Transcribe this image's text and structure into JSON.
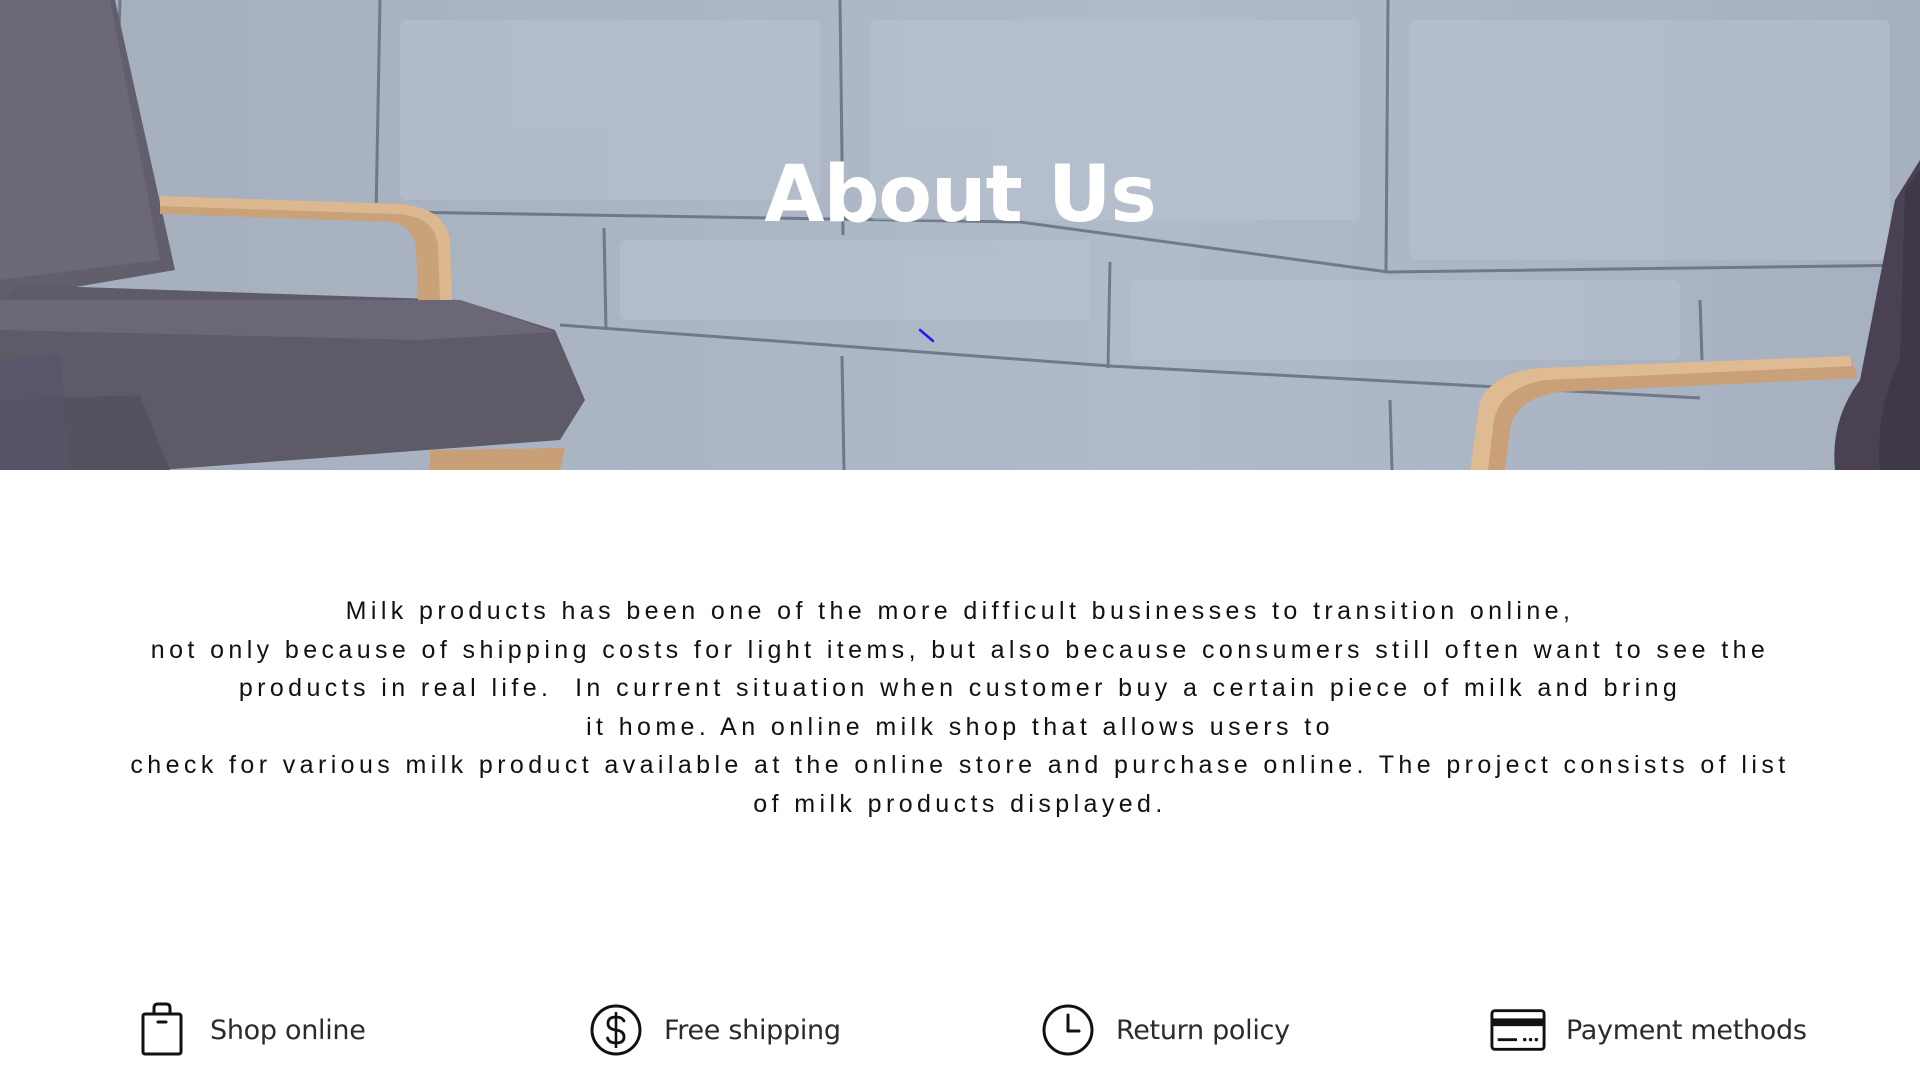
{
  "hero": {
    "title": "About Us"
  },
  "about": {
    "lines": [
      "Milk products has been one of the more difficult businesses to transition online,",
      "not only because of shipping costs for light items, but also because consumers still often want to see the",
      "products in real life.  In current situation when customer buy a certain piece of milk and bring",
      "it home. An online milk shop that allows users to",
      "check for various milk product available at the online store and purchase online. The project consists of list",
      "of milk products displayed."
    ]
  },
  "features": [
    {
      "label": "Shop online",
      "icon": "shopping-bag-icon"
    },
    {
      "label": "Free shipping",
      "icon": "dollar-circle-icon"
    },
    {
      "label": "Return policy",
      "icon": "clock-icon"
    },
    {
      "label": "Payment methods",
      "icon": "credit-card-icon"
    }
  ],
  "colors": {
    "hero_wall": "#aab4c3",
    "title": "#ffffff",
    "body_text": "#111111",
    "feature_text": "#2b2b2b"
  }
}
